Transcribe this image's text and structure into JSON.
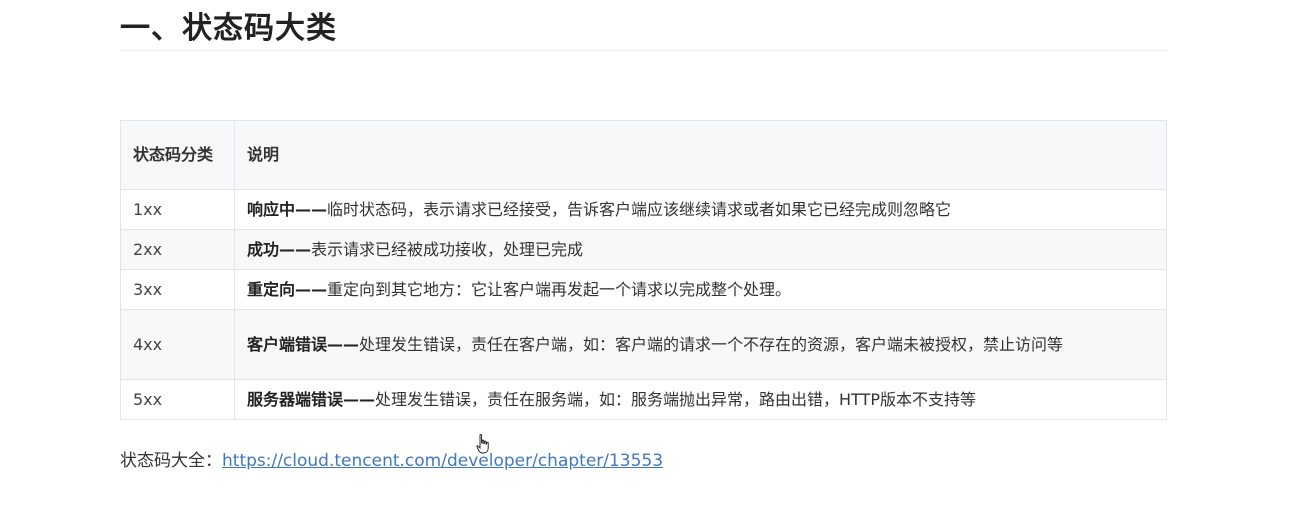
{
  "heading": "一、状态码大类",
  "table": {
    "headers": [
      "状态码分类",
      "说明"
    ],
    "rows": [
      {
        "code": "1xx",
        "title": "响应中——",
        "text": "临时状态码，表示请求已经接受，告诉客户端应该继续请求或者如果它已经完成则忽略它"
      },
      {
        "code": "2xx",
        "title": "成功——",
        "text": "表示请求已经被成功接收，处理已完成"
      },
      {
        "code": "3xx",
        "title": "重定向——",
        "text": "重定向到其它地方：它让客户端再发起一个请求以完成整个处理。"
      },
      {
        "code": "4xx",
        "title": "客户端错误——",
        "text": "处理发生错误，责任在客户端，如：客户端的请求一个不存在的资源，客户端未被授权，禁止访问等"
      },
      {
        "code": "5xx",
        "title": "服务器端错误——",
        "text": "处理发生错误，责任在服务端，如：服务端抛出异常，路由出错，HTTP版本不支持等"
      }
    ]
  },
  "footer": {
    "label": "状态码大全：",
    "link_text": "https://cloud.tencent.com/developer/chapter/13553"
  }
}
